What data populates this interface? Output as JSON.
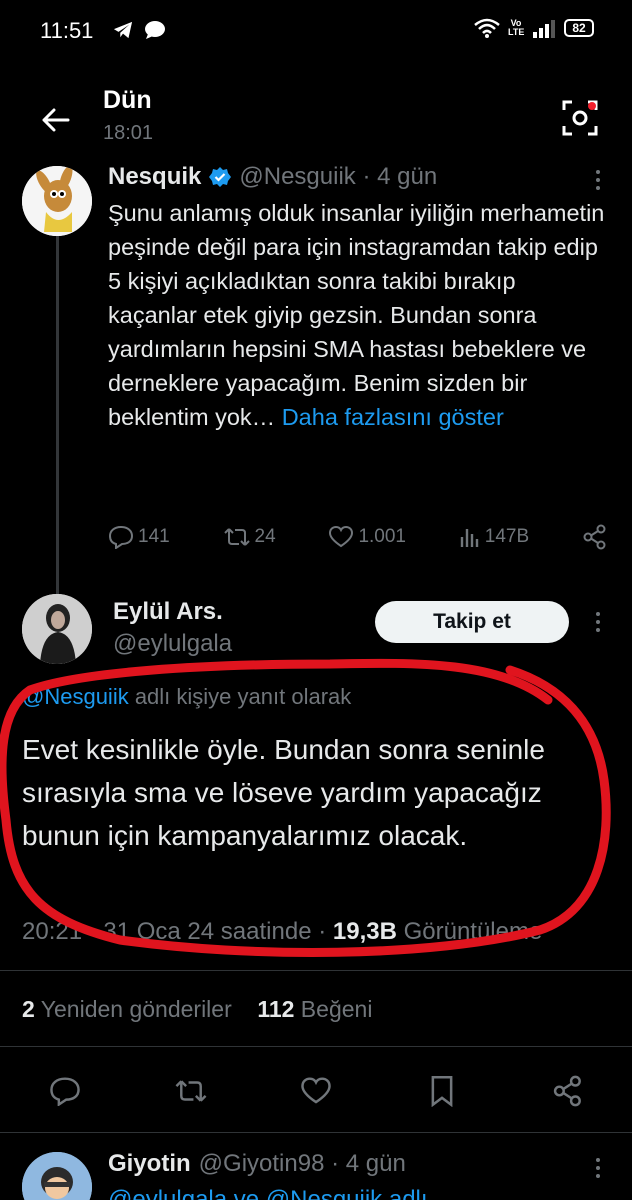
{
  "status_bar": {
    "time": "11:51",
    "network_label": "Vo LTE",
    "battery": "82"
  },
  "header": {
    "title": "Dün",
    "subtitle": "18:01"
  },
  "quoted_tweet": {
    "name": "Nesquik",
    "handle": "@Nesguiik · 4 gün",
    "text": "Şunu anlamış olduk insanlar iyiliğin merhametin peşinde değil para için instagramdan takip edip 5 kişiyi açıkladıktan sonra takibi bırakıp kaçanlar etek giyip gezsin. Bundan sonra yardımların hepsini SMA hastası bebeklere ve derneklere yapacağım. Benim sizden bir beklentim yok… ",
    "show_more": "Daha fazlasını göster",
    "replies": "141",
    "retweets": "24",
    "likes": "1.001",
    "views": "147B"
  },
  "main_tweet": {
    "name": "Eylül Ars.",
    "handle": "@eylulgala",
    "follow_label": "Takip et",
    "reply_mention": "@Nesguiik",
    "reply_suffix": " adlı kişiye yanıt olarak",
    "text": "Evet kesinlikle öyle. Bundan sonra seninle sırasıyla sma ve löseve yardım yapacağız bunun için kampanyalarımız olacak.",
    "time_date": "20:21 · 31 Oca 24 saatinde · ",
    "views_count": "19,3B",
    "views_label": " Görüntüleme",
    "retweet_count": "2",
    "retweet_label": " Yeniden gönderiler",
    "like_count": "112",
    "like_label": " Beğeni"
  },
  "next_reply": {
    "name": "Giyotin",
    "handle": "@Giyotin98 · 4 gün",
    "text_preview": "@eylulgala ve @Nesguiik adlı"
  },
  "colors": {
    "background": "#000000",
    "accent": "#1d9bf0",
    "muted": "#71767b",
    "annotation": "#e0141e"
  }
}
